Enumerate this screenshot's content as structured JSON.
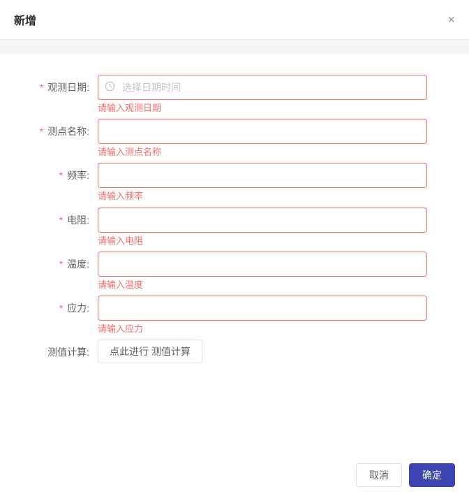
{
  "dialog": {
    "title": "新增",
    "close_label": "×"
  },
  "form": {
    "fields": [
      {
        "label": "观测日期",
        "placeholder": "选择日期时间",
        "error": "请输入观测日期",
        "has_date_icon": true
      },
      {
        "label": "测点名称",
        "placeholder": "",
        "error": "请输入测点名称",
        "has_date_icon": false
      },
      {
        "label": "频率",
        "placeholder": "",
        "error": "请输入频率",
        "has_date_icon": false
      },
      {
        "label": "电阻",
        "placeholder": "",
        "error": "请输入电阻",
        "has_date_icon": false
      },
      {
        "label": "温度",
        "placeholder": "",
        "error": "请输入温度",
        "has_date_icon": false
      },
      {
        "label": "应力",
        "placeholder": "",
        "error": "请输入应力",
        "has_date_icon": false
      }
    ],
    "calc_label": "测值计算",
    "calc_button": "点此进行 测值计算"
  },
  "footer": {
    "cancel": "取消",
    "confirm": "确定"
  }
}
